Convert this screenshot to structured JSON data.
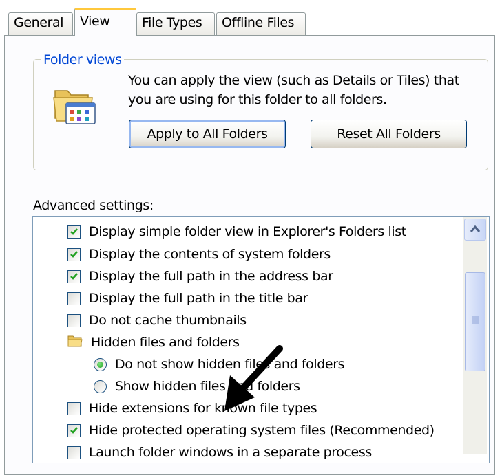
{
  "tabs": [
    {
      "label": "General",
      "active": false
    },
    {
      "label": "View",
      "active": true
    },
    {
      "label": "File Types",
      "active": false
    },
    {
      "label": "Offline Files",
      "active": false
    }
  ],
  "folder_views": {
    "legend": "Folder views",
    "description": "You can apply the view (such as Details or Tiles) that you are using for this folder to all folders.",
    "apply_button": "Apply to All Folders",
    "reset_button": "Reset All Folders",
    "icon": "folder-icon"
  },
  "advanced": {
    "label": "Advanced settings:",
    "items": [
      {
        "label": "Display simple folder view in Explorer's Folders list",
        "kind": "checkbox",
        "checked": true
      },
      {
        "label": "Display the contents of system folders",
        "kind": "checkbox",
        "checked": true
      },
      {
        "label": "Display the full path in the address bar",
        "kind": "checkbox",
        "checked": true
      },
      {
        "label": "Display the full path in the title bar",
        "kind": "checkbox",
        "checked": false
      },
      {
        "label": "Do not cache thumbnails",
        "kind": "checkbox",
        "checked": false
      },
      {
        "label": "Hidden files and folders",
        "kind": "folder"
      },
      {
        "label": "Do not show hidden files and folders",
        "kind": "radio",
        "checked": true
      },
      {
        "label": "Show hidden files and folders",
        "kind": "radio",
        "checked": false
      },
      {
        "label": "Hide extensions for known file types",
        "kind": "checkbox",
        "checked": false
      },
      {
        "label": "Hide protected operating system files (Recommended)",
        "kind": "checkbox",
        "checked": true
      },
      {
        "label": "Launch folder windows in a separate process",
        "kind": "checkbox",
        "checked": false
      }
    ]
  },
  "colors": {
    "accent_legend": "#0046d5",
    "check_green": "#21a121",
    "tab_highlight": "#ffc83c"
  }
}
